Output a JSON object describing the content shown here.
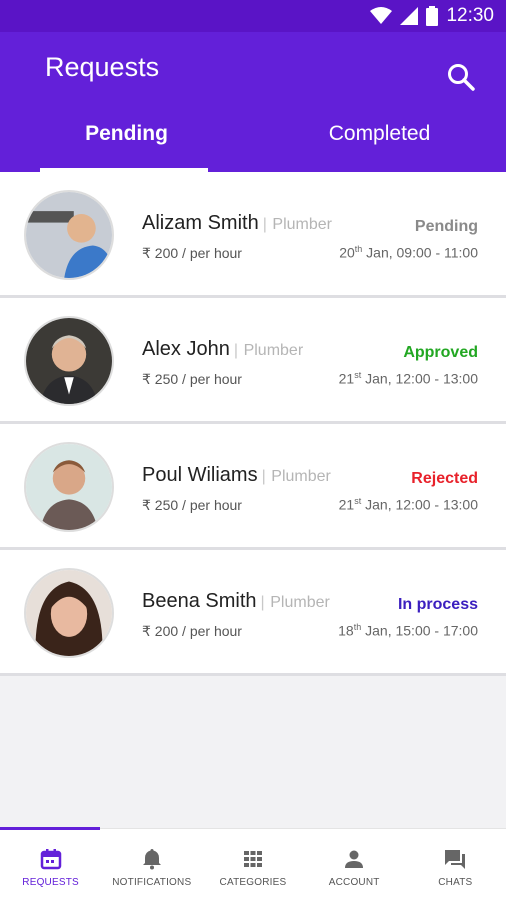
{
  "status_bar": {
    "time": "12:30"
  },
  "header": {
    "title": "Requests"
  },
  "tabs": [
    {
      "label": "Pending"
    },
    {
      "label": "Completed"
    }
  ],
  "requests": [
    {
      "name": "Alizam Smith",
      "separator": "|",
      "role": "Plumber",
      "rate": "₹ 200 / per hour",
      "status": "Pending",
      "status_color": "#8a8a8a",
      "date_day": "20",
      "date_sup": "th",
      "date_rest": " Jan, 09:00 - 11:00"
    },
    {
      "name": "Alex John",
      "separator": "|",
      "role": "Plumber",
      "rate": "₹ 250 / per hour",
      "status": "Approved",
      "status_color": "#22a722",
      "date_day": "21",
      "date_sup": "st",
      "date_rest": " Jan, 12:00 - 13:00"
    },
    {
      "name": "Poul Wiliams",
      "separator": "|",
      "role": "Plumber",
      "rate": "₹ 250 / per hour",
      "status": "Rejected",
      "status_color": "#e8212a",
      "date_day": "21",
      "date_sup": "st",
      "date_rest": " Jan, 12:00 - 13:00"
    },
    {
      "name": "Beena Smith",
      "separator": "|",
      "role": "Plumber",
      "rate": "₹ 200 / per hour",
      "status": "In process",
      "status_color": "#3b1fbf",
      "date_day": "18",
      "date_sup": "th",
      "date_rest": " Jan, 15:00 - 17:00"
    }
  ],
  "bottom_nav": [
    {
      "label": "REQUESTS",
      "icon": "calendar-icon"
    },
    {
      "label": "NOTIFICATIONS",
      "icon": "bell-icon"
    },
    {
      "label": "CATEGORIES",
      "icon": "grid-icon"
    },
    {
      "label": "ACCOUNT",
      "icon": "person-icon"
    },
    {
      "label": "CHATS",
      "icon": "chat-icon"
    }
  ],
  "colors": {
    "primary": "#6320d9",
    "status_bar": "#5a14c6"
  }
}
